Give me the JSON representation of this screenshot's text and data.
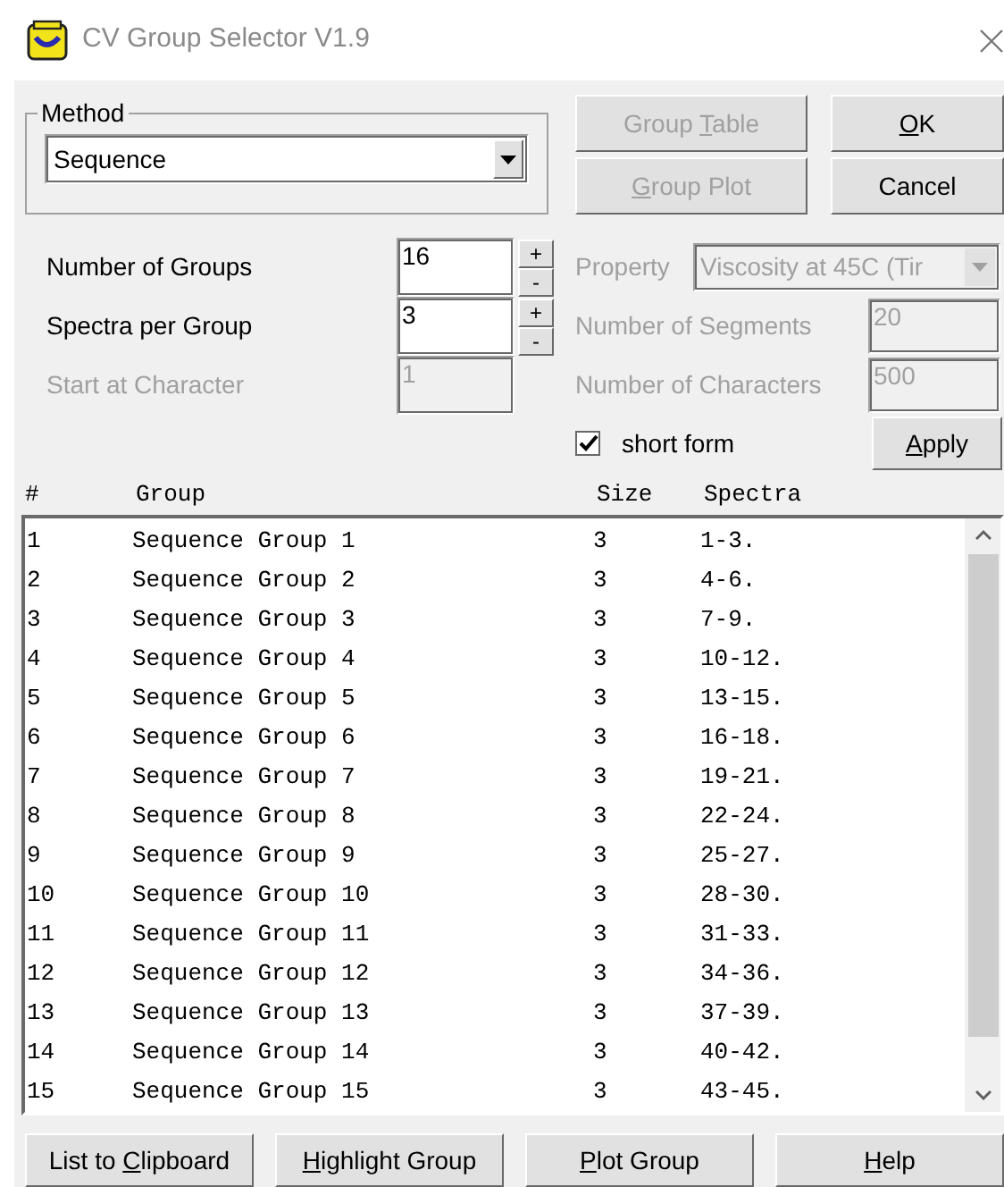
{
  "window": {
    "title": "CV Group Selector V1.9"
  },
  "method": {
    "legend": "Method",
    "value": "Sequence"
  },
  "top_buttons": [
    {
      "before": "Group ",
      "key": "T",
      "after": "able",
      "disabled": true
    },
    {
      "key": "O",
      "after": "K",
      "disabled": false
    },
    {
      "key": "G",
      "after": "roup Plot",
      "disabled": true
    },
    {
      "before": "Cancel",
      "disabled": false
    }
  ],
  "left_fields": [
    {
      "label": "Number of Groups",
      "value": "16",
      "disabled": false,
      "spinner": {
        "up": "+",
        "down": "-"
      }
    },
    {
      "label": "Spectra per Group",
      "value": "3",
      "disabled": false,
      "spinner": {
        "up": "+",
        "down": "-"
      }
    },
    {
      "label": "Start at Character",
      "value": "1",
      "disabled": true
    }
  ],
  "property": {
    "label": "Property",
    "value": "Viscosity at 45C (Tir",
    "disabled": true
  },
  "right_fields": [
    {
      "label": "Number of Segments",
      "value": "20",
      "disabled": true
    },
    {
      "label": "Number of Characters",
      "value": "500",
      "disabled": true
    }
  ],
  "short_form": {
    "label": "short form",
    "checked": true
  },
  "apply_button": {
    "key": "A",
    "after": "pply",
    "disabled": false
  },
  "table": {
    "columns": [
      "#",
      "Group",
      "Size",
      "Spectra"
    ],
    "rows": [
      [
        "1",
        "Sequence Group 1",
        "3",
        "1-3."
      ],
      [
        "2",
        "Sequence Group 2",
        "3",
        "4-6."
      ],
      [
        "3",
        "Sequence Group 3",
        "3",
        "7-9."
      ],
      [
        "4",
        "Sequence Group 4",
        "3",
        "10-12."
      ],
      [
        "5",
        "Sequence Group 5",
        "3",
        "13-15."
      ],
      [
        "6",
        "Sequence Group 6",
        "3",
        "16-18."
      ],
      [
        "7",
        "Sequence Group 7",
        "3",
        "19-21."
      ],
      [
        "8",
        "Sequence Group 8",
        "3",
        "22-24."
      ],
      [
        "9",
        "Sequence Group 9",
        "3",
        "25-27."
      ],
      [
        "10",
        "Sequence Group 10",
        "3",
        "28-30."
      ],
      [
        "11",
        "Sequence Group 11",
        "3",
        "31-33."
      ],
      [
        "12",
        "Sequence Group 12",
        "3",
        "34-36."
      ],
      [
        "13",
        "Sequence Group 13",
        "3",
        "37-39."
      ],
      [
        "14",
        "Sequence Group 14",
        "3",
        "40-42."
      ],
      [
        "15",
        "Sequence Group 15",
        "3",
        "43-45."
      ]
    ]
  },
  "bottom_buttons": [
    {
      "before": "List to ",
      "key": "C",
      "after": "lipboard",
      "disabled": false
    },
    {
      "key": "H",
      "after": "ighlight Group",
      "disabled": false
    },
    {
      "key": "P",
      "after": "lot Group",
      "disabled": false
    },
    {
      "key": "H",
      "after": "elp",
      "disabled": false
    }
  ]
}
